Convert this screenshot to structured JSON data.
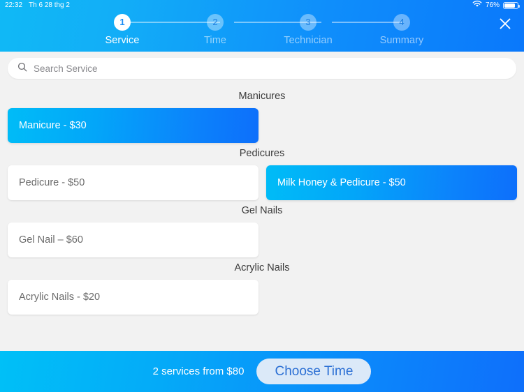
{
  "status_bar": {
    "time": "22:32",
    "date": "Th 6 28 thg 2",
    "battery_percent": "76%",
    "wifi_icon": "wifi-icon",
    "battery_icon": "battery-icon"
  },
  "header": {
    "close_icon": "close-icon",
    "steps": [
      {
        "number": "1",
        "label": "Service",
        "state": "active"
      },
      {
        "number": "2",
        "label": "Time",
        "state": "inactive"
      },
      {
        "number": "3",
        "label": "Technician",
        "state": "inactive"
      },
      {
        "number": "4",
        "label": "Summary",
        "state": "inactive"
      }
    ]
  },
  "search": {
    "icon": "search-icon",
    "value": "",
    "placeholder": "Search Service"
  },
  "categories": [
    {
      "title": "Manicures",
      "services": [
        {
          "label": "Manicure - $30",
          "selected": true
        }
      ]
    },
    {
      "title": "Pedicures",
      "services": [
        {
          "label": "Pedicure - $50",
          "selected": false
        },
        {
          "label": "Milk Honey & Pedicure - $50",
          "selected": true
        }
      ]
    },
    {
      "title": "Gel Nails",
      "services": [
        {
          "label": "Gel Nail – $60",
          "selected": false
        }
      ]
    },
    {
      "title": "Acrylic Nails",
      "services": [
        {
          "label": "Acrylic Nails - $20",
          "selected": false
        }
      ]
    }
  ],
  "bottom_bar": {
    "summary": "2 services from $80",
    "cta_label": "Choose Time"
  },
  "colors": {
    "gradient_start": "#00bcf7",
    "gradient_end": "#0d6ffb",
    "page_background": "#f2f2f2",
    "card_text": "#6b6b6b",
    "cta_text": "#2b6fd4"
  }
}
